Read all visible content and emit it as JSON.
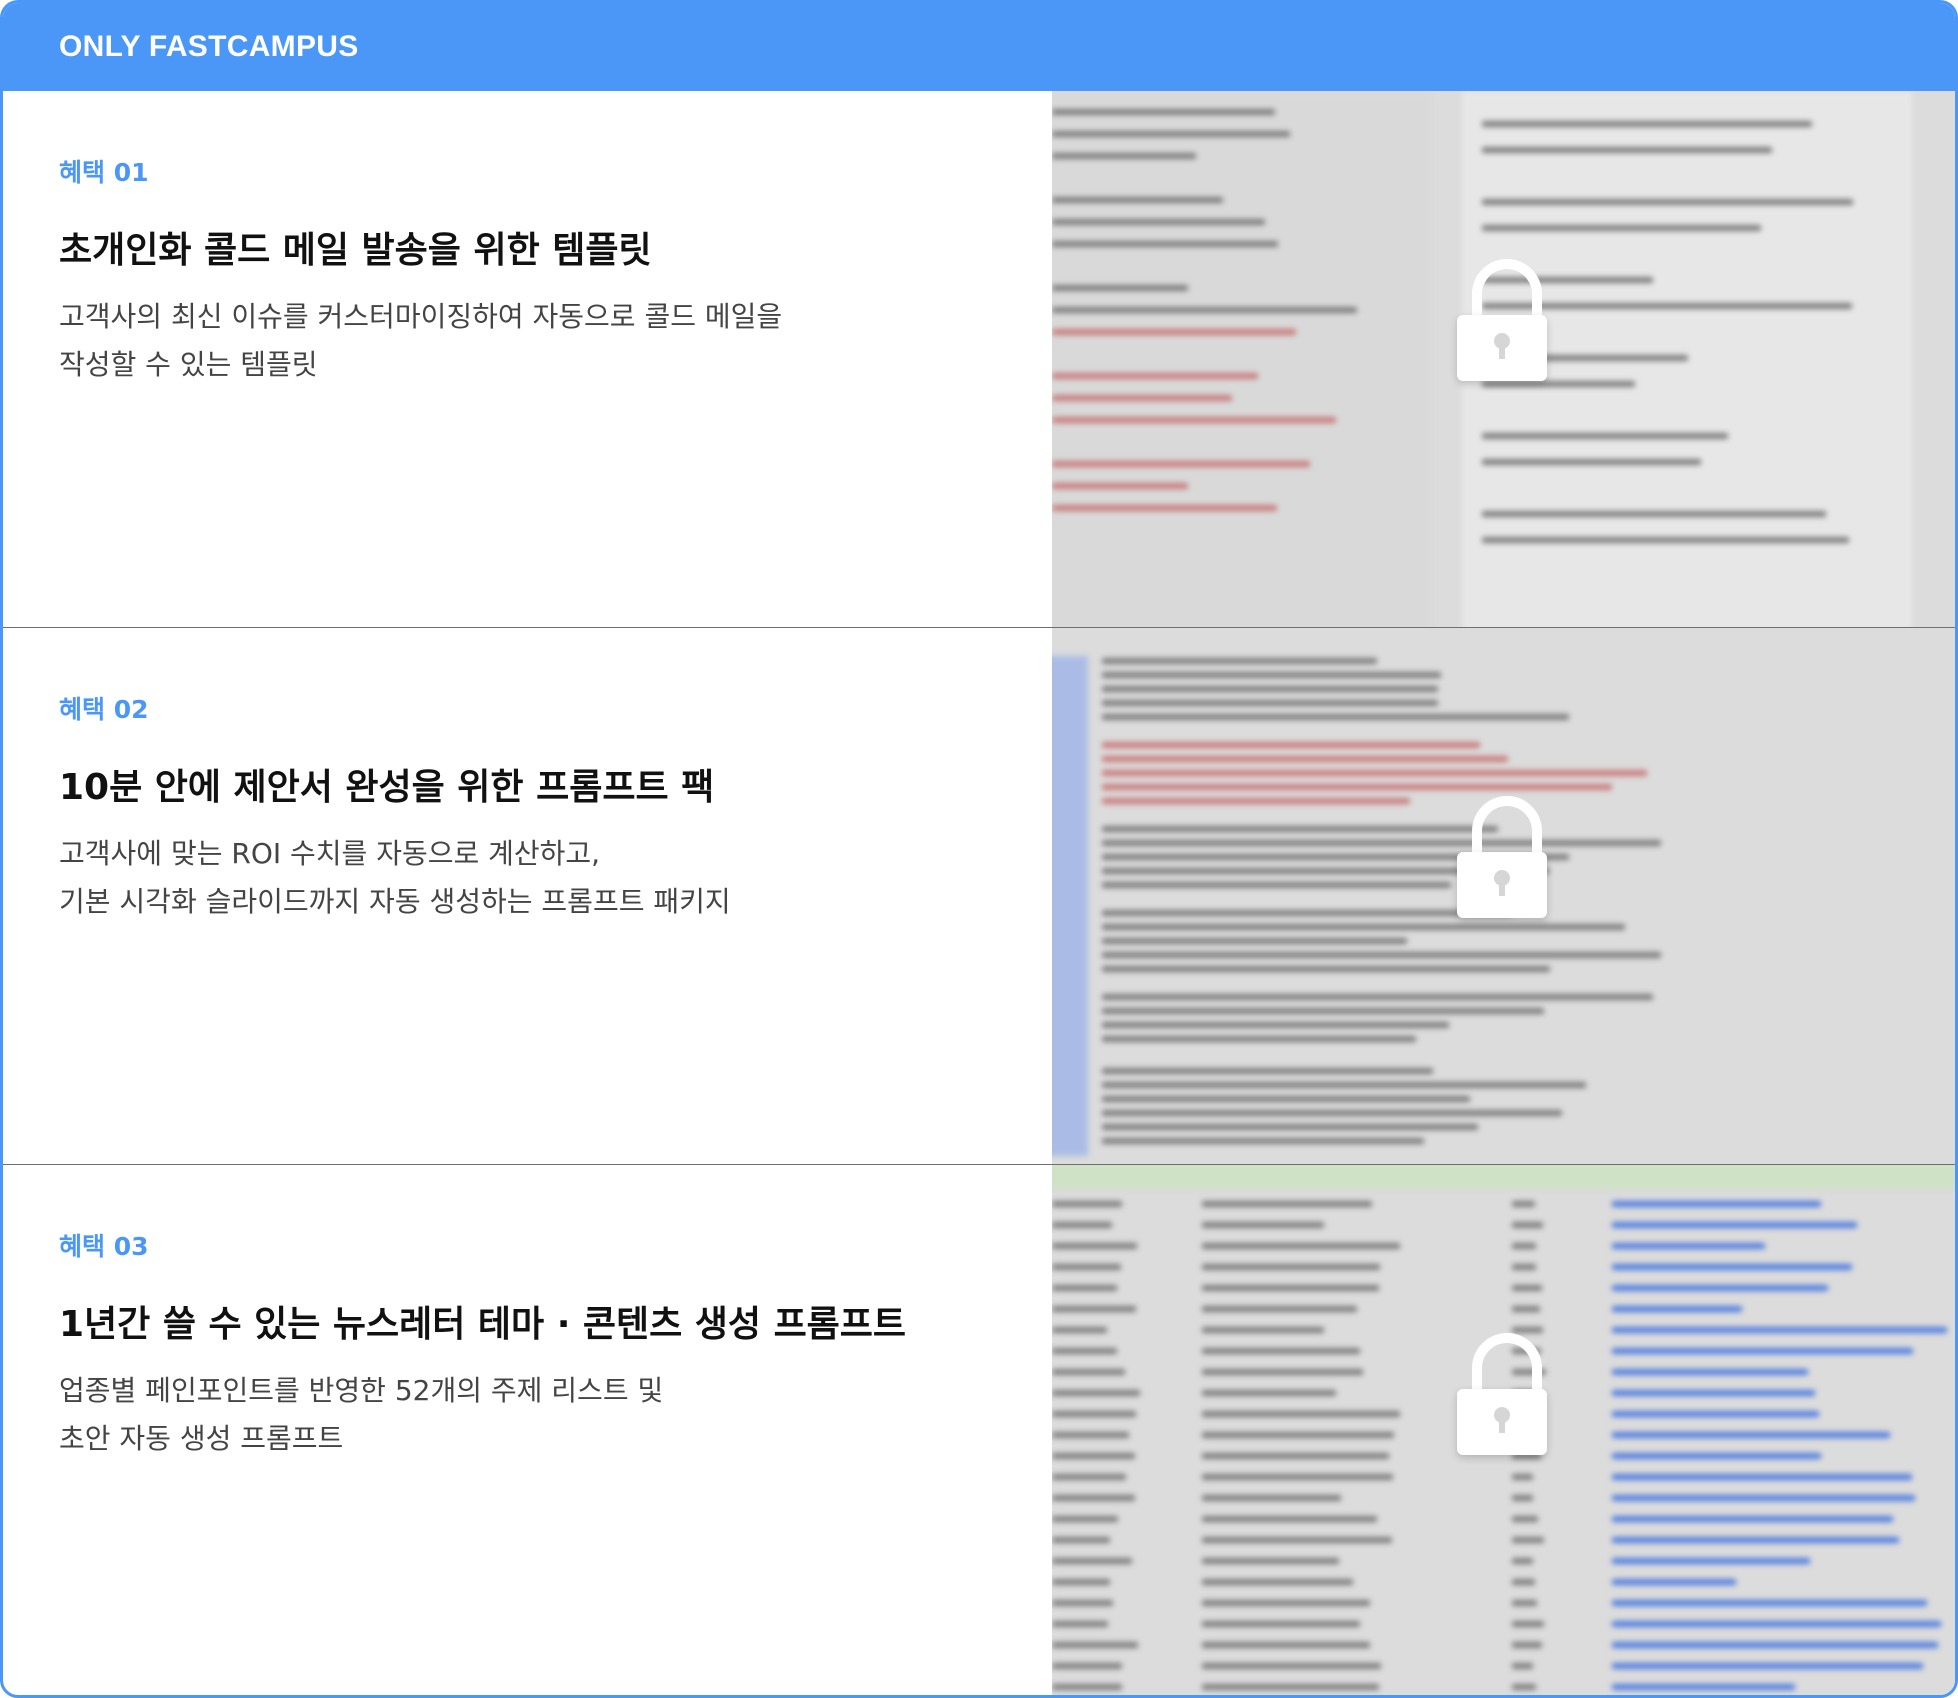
{
  "header": {
    "title": "ONLY FASTCAMPUS"
  },
  "benefits": [
    {
      "badge": "혜택 01",
      "title": "초개인화 콜드 메일 발송을 위한 템플릿",
      "desc_lines": [
        "고객사의 최신 이슈를 커스터마이징하여 자동으로 콜드 메일을",
        "작성할 수 있는 템플릿"
      ],
      "preview_icon": "lock-icon"
    },
    {
      "badge": "혜택 02",
      "title": "10분 안에 제안서 완성을 위한 프롬프트 팩",
      "desc_lines": [
        "고객사에 맞는 ROI 수치를 자동으로 계산하고,",
        "기본 시각화 슬라이드까지 자동 생성하는 프롬프트 패키지"
      ],
      "preview_icon": "lock-icon"
    },
    {
      "badge": "혜택 03",
      "title": "1년간 쓸 수 있는 뉴스레터 테마 · 콘텐츠 생성 프롬프트",
      "desc_lines": [
        "업종별 페인포인트를 반영한 52개의 주제 리스트 및",
        "초안 자동 생성 프롬프트"
      ],
      "preview_icon": "lock-icon"
    }
  ],
  "colors": {
    "accent": "#4a97f7",
    "title": "#111111",
    "body": "#444444"
  }
}
